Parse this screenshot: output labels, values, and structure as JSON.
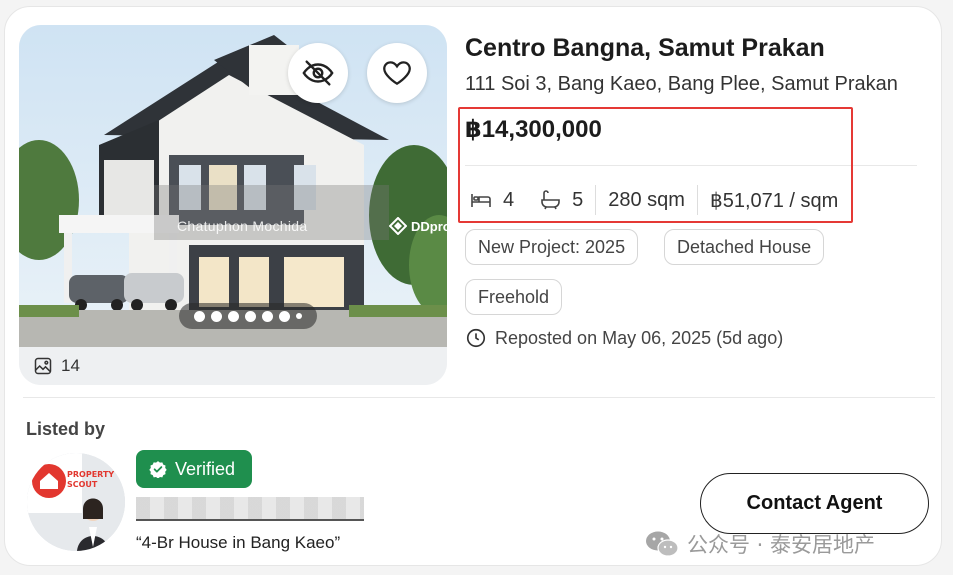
{
  "listing": {
    "title": "Centro Bangna, Samut Prakan",
    "address": "111 Soi 3, Bang Kaeo, Bang Plee, Samut Prakan",
    "price": "฿14,300,000",
    "bedrooms": "4",
    "bathrooms": "5",
    "area": "280 sqm",
    "price_per_sqm": "฿51,071 / sqm",
    "tags": [
      "New Project: 2025",
      "Detached House",
      "Freehold"
    ],
    "reposted": "Reposted on May 06, 2025 (5d ago)"
  },
  "photo": {
    "photo_count": "14",
    "watermark": "Chatuphon Mochida",
    "brand_mark": "DDproj",
    "carousel_dots": 7,
    "active_dot": 1
  },
  "agent": {
    "section_label": "Listed by",
    "verified_label": "Verified",
    "listing_quote": "“4-Br House in Bang Kaeo”",
    "contact_label": "Contact Agent"
  },
  "wechat_watermark": "公众号 · 泰安居地产",
  "colors": {
    "highlight": "#e53935",
    "verified": "#1f8f4e",
    "text": "#1c1c1c"
  },
  "icons": [
    "hide-icon",
    "heart-icon",
    "gallery-icon",
    "bed-icon",
    "bath-icon",
    "clock-icon",
    "verified-check-icon",
    "wechat-icon"
  ]
}
